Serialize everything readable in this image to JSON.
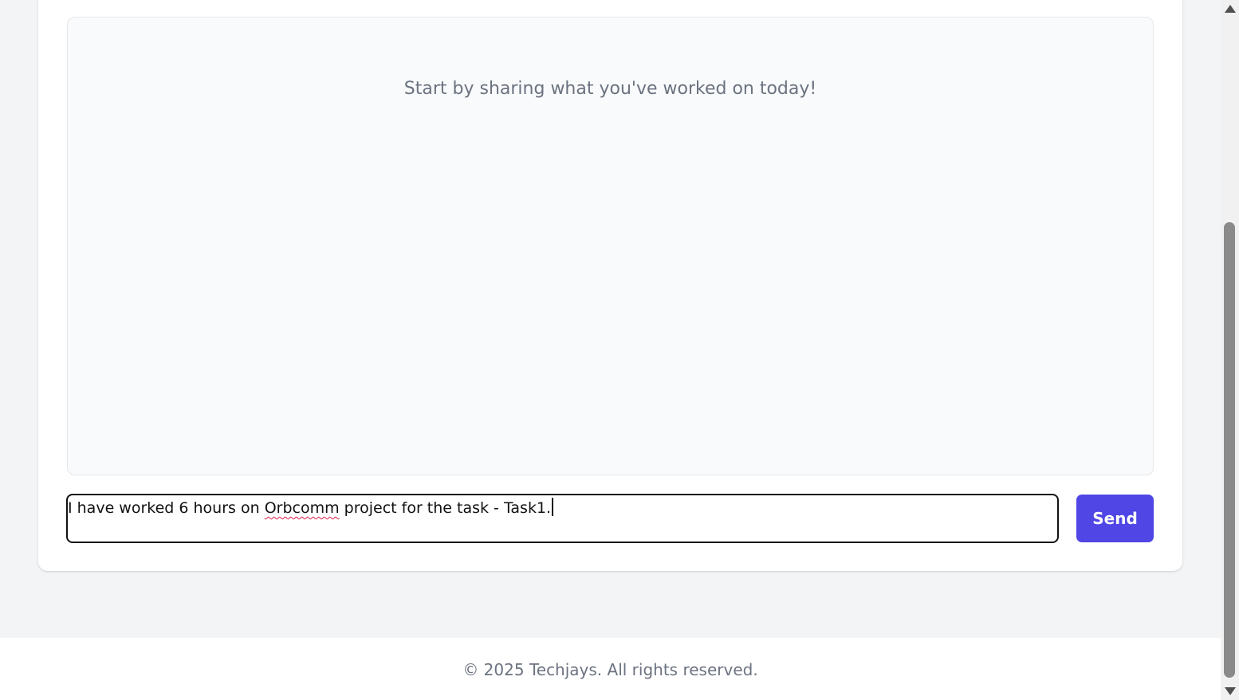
{
  "chat": {
    "empty_message": "Start by sharing what you've worked on today!"
  },
  "composer": {
    "value_before": "I have worked 6 hours on ",
    "value_misspelled": "Orbcomm",
    "value_after": " project for the task - Task1.",
    "send_label": "Send"
  },
  "footer": {
    "copyright": "© 2025 Techjays. All rights reserved."
  },
  "colors": {
    "accent": "#4f46e5",
    "page_bg": "#f3f4f6",
    "muted_text": "#6b7280"
  }
}
